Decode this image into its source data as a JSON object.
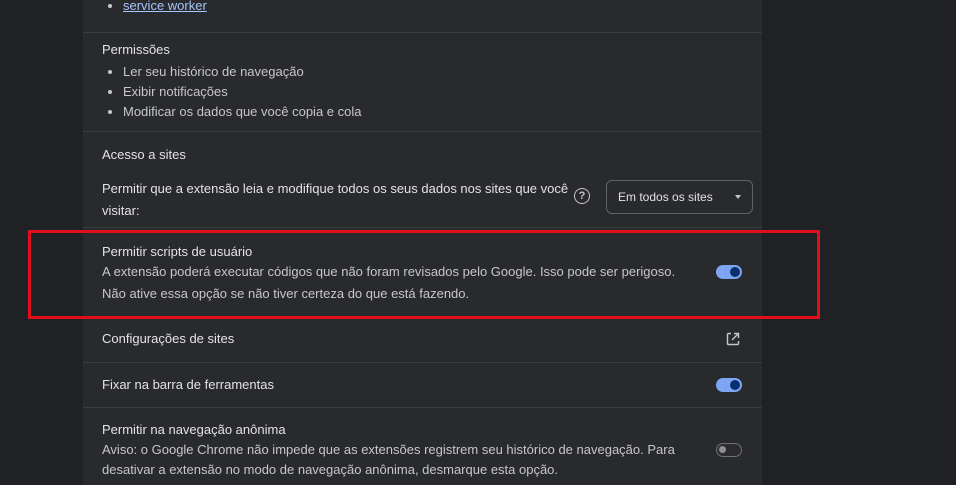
{
  "top_list": {
    "item": "service worker"
  },
  "permissions": {
    "title": "Permissões",
    "items": [
      "Ler seu histórico de navegação",
      "Exibir notificações",
      "Modificar os dados que você copia e cola"
    ]
  },
  "site_access": {
    "title": "Acesso a sites",
    "description": "Permitir que a extensão leia e modifique todos os seus dados nos sites que você visitar:",
    "help_icon": "help-circle-icon",
    "select_value": "Em todos os sites"
  },
  "user_scripts": {
    "title": "Permitir scripts de usuário",
    "description_line1": "A extensão poderá executar códigos que não foram revisados pelo Google. Isso pode ser perigoso.",
    "description_line2": "Não ative essa opção se não tiver certeza do que está fazendo.",
    "toggle_on": true
  },
  "site_settings": {
    "title": "Configurações de sites",
    "icon": "open-in-new-icon"
  },
  "pin_toolbar": {
    "title": "Fixar na barra de ferramentas",
    "toggle_on": true
  },
  "incognito": {
    "title": "Permitir na navegação anônima",
    "description": "Aviso: o Google Chrome não impede que as extensões registrem seu histórico de navegação. Para desativar a extensão no modo de navegação anônima, desmarque esta opção.",
    "toggle_on": false
  },
  "colors": {
    "page_bg": "#202124",
    "card_bg": "#292a2d",
    "toggle_on": "#7ca6f4",
    "highlight": "#e0101b",
    "link": "#a8c7fa"
  }
}
